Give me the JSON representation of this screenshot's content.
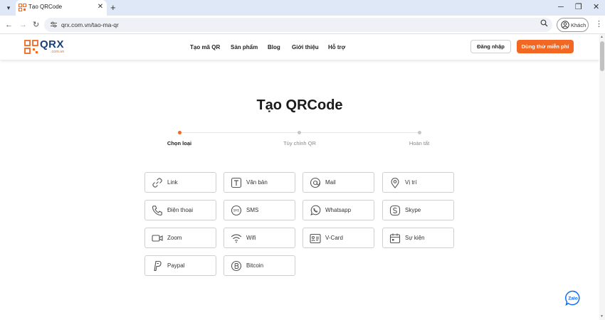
{
  "browser": {
    "tab_title": "Tạo QRCode",
    "new_tab": "+",
    "close_tab": "✕",
    "url": "qrx.com.vn/tao-ma-qr",
    "profile_label": "Khách",
    "window_controls": [
      "─",
      "❐",
      "✕"
    ]
  },
  "header": {
    "logo_text": "QRX",
    "logo_sub": ".com.vn",
    "nav": [
      "Tạo mã QR",
      "Sản phẩm",
      "Blog",
      "Giới thiệu",
      "Hỗ trợ"
    ],
    "login_label": "Đăng nhập",
    "trial_label": "Dùng thử miễn phí"
  },
  "main": {
    "title": "Tạo QRCode",
    "steps": [
      {
        "label": "Chọn loại",
        "active": true
      },
      {
        "label": "Tùy chỉnh QR",
        "active": false
      },
      {
        "label": "Hoàn tất",
        "active": false
      }
    ],
    "qr_types": [
      {
        "label": "Link",
        "icon": "link-icon"
      },
      {
        "label": "Văn bản",
        "icon": "text-icon"
      },
      {
        "label": "Mail",
        "icon": "mail-icon"
      },
      {
        "label": "Vị trí",
        "icon": "location-pin-icon"
      },
      {
        "label": "Điện thoại",
        "icon": "phone-icon"
      },
      {
        "label": "SMS",
        "icon": "sms-icon"
      },
      {
        "label": "Whatsapp",
        "icon": "whatsapp-icon"
      },
      {
        "label": "Skype",
        "icon": "skype-icon"
      },
      {
        "label": "Zoom",
        "icon": "video-camera-icon"
      },
      {
        "label": "Wifi",
        "icon": "wifi-icon"
      },
      {
        "label": "V-Card",
        "icon": "vcard-icon"
      },
      {
        "label": "Sự kiện",
        "icon": "calendar-icon"
      },
      {
        "label": "Paypal",
        "icon": "paypal-icon"
      },
      {
        "label": "Bitcoin",
        "icon": "bitcoin-icon"
      }
    ]
  },
  "colors": {
    "accent": "#f26722",
    "brand_blue": "#1c3f7a",
    "tabstrip": "#dfe8f6"
  }
}
